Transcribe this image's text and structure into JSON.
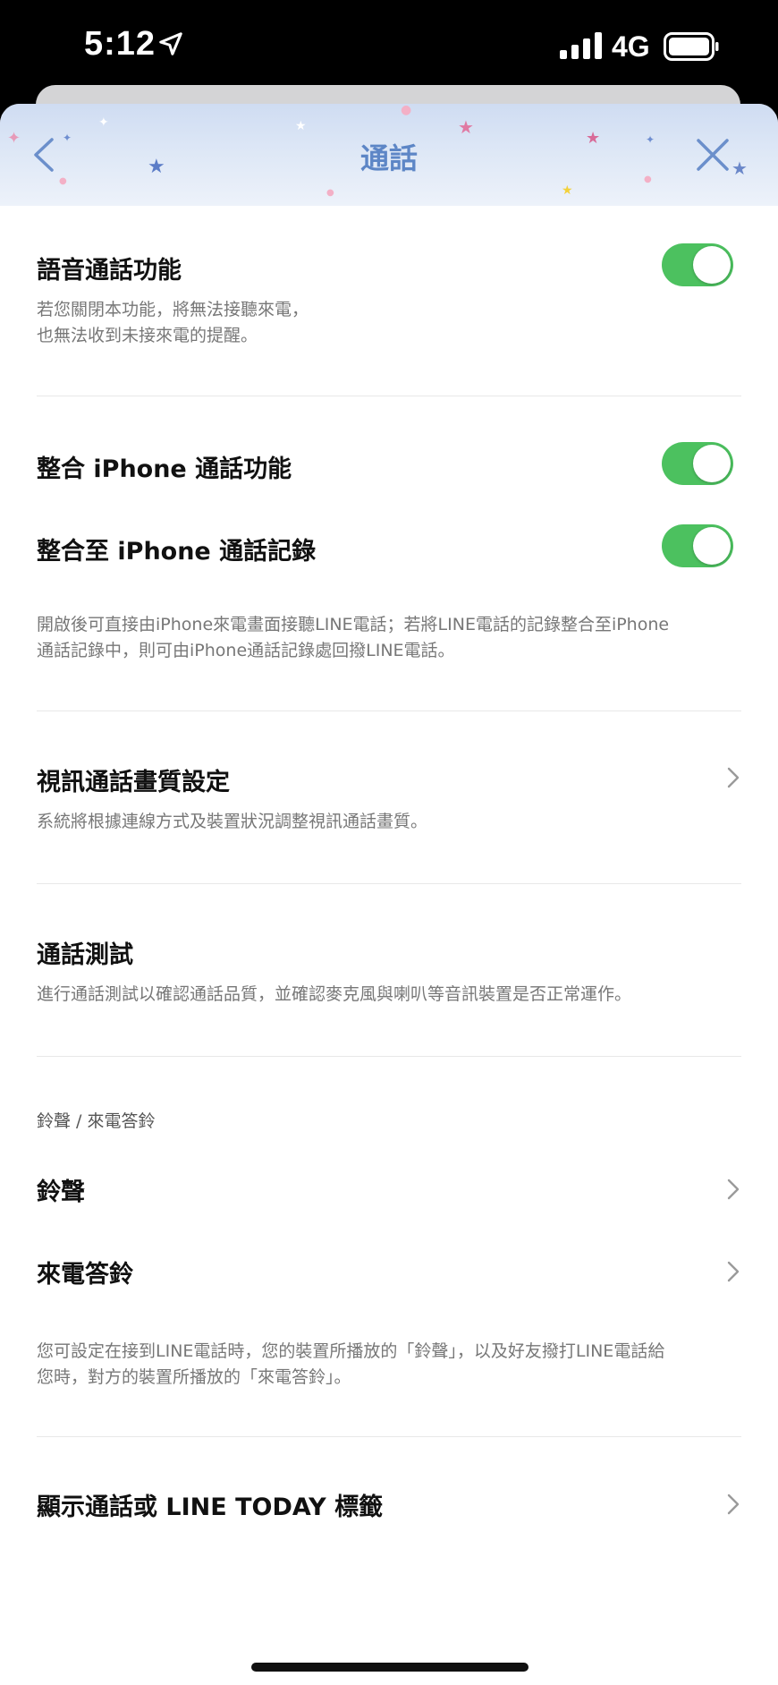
{
  "status_bar": {
    "time": "5:12",
    "network": "4G"
  },
  "header": {
    "title": "通話"
  },
  "sections": {
    "voice_call": {
      "title": "語音通話功能",
      "desc_line1": "若您關閉本功能，將無法接聽來電，",
      "desc_line2": "也無法收到未接來電的提醒。",
      "toggle_on": true
    },
    "iphone_integration": {
      "title": "整合 iPhone 通話功能",
      "toggle_on": true
    },
    "iphone_history": {
      "title": "整合至 iPhone 通話記錄",
      "toggle_on": true,
      "desc_line1": "開啟後可直接由iPhone來電畫面接聽LINE電話；若將LINE電話的記錄整合至iPhone",
      "desc_line2": "通話記錄中，則可由iPhone通話記錄處回撥LINE電話。"
    },
    "video_quality": {
      "title": "視訊通話畫質設定",
      "desc": "系統將根據連線方式及裝置狀況調整視訊通話畫質。"
    },
    "call_test": {
      "title": "通話測試",
      "desc": "進行通話測試以確認通話品質，並確認麥克風與喇叭等音訊裝置是否正常運作。"
    },
    "ringtone_section": {
      "label": "鈴聲 / 來電答鈴",
      "ringtone": "鈴聲",
      "ringback": "來電答鈴",
      "desc_line1": "您可設定在接到LINE電話時，您的裝置所播放的「鈴聲」，以及好友撥打LINE電話給",
      "desc_line2": "您時，對方的裝置所播放的「來電答鈴」。"
    },
    "show_label": {
      "title": "顯示通話或 LINE TODAY 標籤"
    }
  },
  "colors": {
    "toggle_on": "#4cc15f",
    "header_accent": "#5d86c6",
    "desc_text": "#777777"
  },
  "icons": [
    "location-arrow-icon",
    "signal-icon",
    "battery-icon",
    "back-chevron-icon",
    "close-icon",
    "chevron-right-icon",
    "star-icon"
  ]
}
